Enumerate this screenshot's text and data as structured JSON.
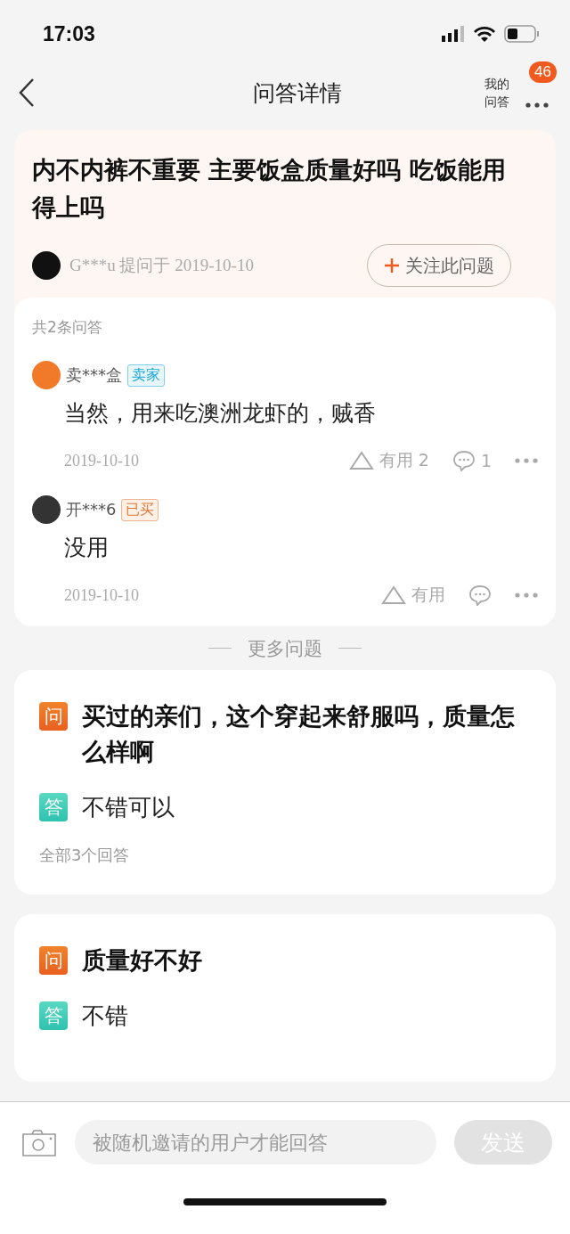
{
  "status_bar": {
    "time": "17:03"
  },
  "nav": {
    "title": "问答详情",
    "my_qa": [
      "我的",
      "问答"
    ],
    "badge": "46"
  },
  "question": {
    "title": "内不内裤不重要 主要饭盒质量好吗 吃饭能用得上吗",
    "asker": "G***u",
    "asked_label": "提问于",
    "date": "2019-10-10",
    "follow_button": "关注此问题"
  },
  "answers": {
    "count_label": "共2条问答",
    "items": [
      {
        "user": "卖***盒",
        "color": "#f07a2a",
        "badge": {
          "kind": "seller",
          "label": "卖家"
        },
        "text": "当然，用来吃澳洲龙虾的，贼香",
        "date": "2019-10-10",
        "useful": "有用",
        "useful_count": "2",
        "comment_count": "1"
      },
      {
        "user": "开***6",
        "color": "#333333",
        "badge": {
          "kind": "bought",
          "label": "已买"
        },
        "text": "没用",
        "date": "2019-10-10",
        "useful": "有用"
      }
    ]
  },
  "more_label": "更多问题",
  "more_questions": [
    {
      "q_mark": "问",
      "question": "买过的亲们，这个穿起来舒服吗，质量怎么样啊",
      "a_mark": "答",
      "answer": "不错可以",
      "all_answers": "全部3个回答"
    },
    {
      "q_mark": "问",
      "question": "质量好不好",
      "a_mark": "答",
      "answer": "不错"
    }
  ],
  "composer": {
    "placeholder": "被随机邀请的用户才能回答",
    "send": "发送"
  }
}
